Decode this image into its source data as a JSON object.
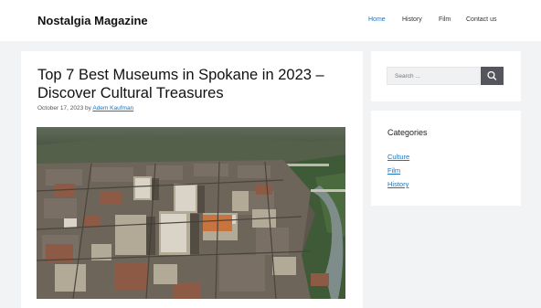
{
  "site": {
    "title": "Nostalgia Magazine"
  },
  "nav": {
    "items": [
      {
        "label": "Home"
      },
      {
        "label": "History"
      },
      {
        "label": "Film"
      },
      {
        "label": "Contact us"
      }
    ]
  },
  "post": {
    "title": "Top 7 Best Museums in Spokane in 2023 – Discover Cultural Treasures",
    "date": "October 17, 2023",
    "by": "by",
    "author": "Adem Kaufman"
  },
  "sidebar": {
    "search": {
      "placeholder": "Search ..."
    },
    "categories": {
      "title": "Categories",
      "items": [
        {
          "label": "Culture"
        },
        {
          "label": "Film"
        },
        {
          "label": "History"
        }
      ]
    }
  },
  "colors": {
    "link": "#1e73be",
    "search_button": "#55555e",
    "page_bg": "#f2f3f5"
  }
}
